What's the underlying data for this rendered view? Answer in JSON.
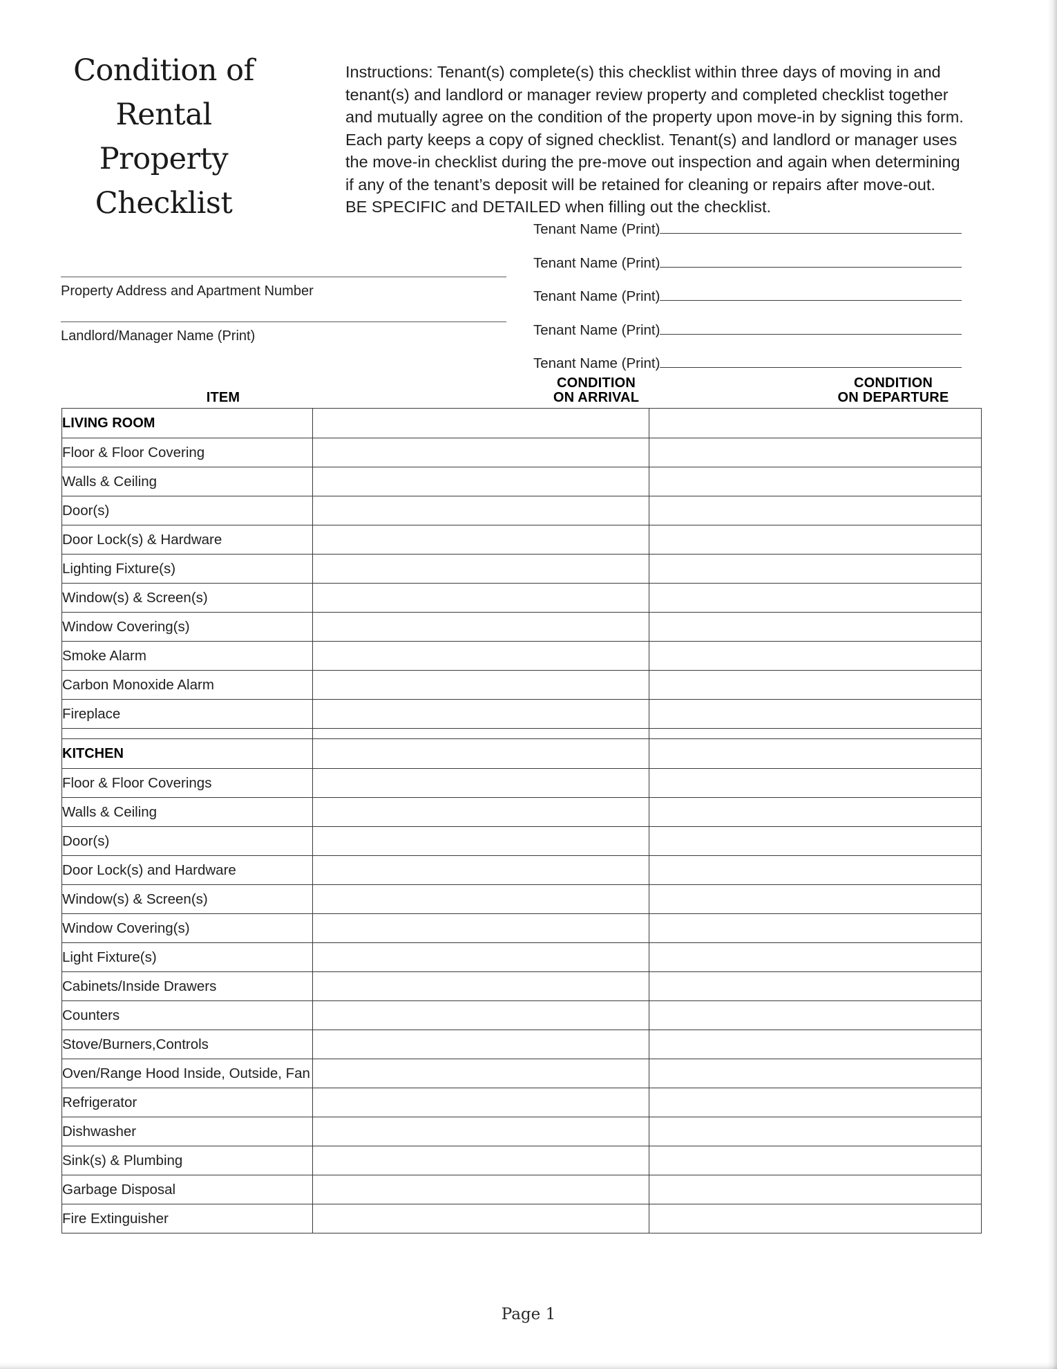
{
  "document": {
    "title_lines": [
      "Condition of",
      "Rental",
      "Property",
      "Checklist"
    ],
    "instructions_label": "Instructions:",
    "instructions_body": "Instructions:  Tenant(s) complete(s) this checklist within three days of moving in and tenant(s) and landlord or manager review property and completed checklist together and mutually agree on the condition of the property upon move-in by signing this form.  Each party keeps a copy of signed checklist.  Tenant(s) and landlord or manager uses the move-in checklist during the pre-move out inspection and again when determining if any of the tenant’s deposit will be retained for cleaning or repairs after move-out.",
    "instructions_emphasis": "BE SPECIFIC and DETAILED when filling out the checklist.",
    "footer": "Page 1"
  },
  "fields": {
    "property_address_label": "Property Address and Apartment Number",
    "landlord_name_label": "Landlord/Manager Name (Print)",
    "property_address_value": "",
    "landlord_name_value": "",
    "tenant_name_label": "Tenant Name (Print)",
    "tenant_lines": [
      {
        "label": "Tenant Name (Print)",
        "value": ""
      },
      {
        "label": "Tenant Name (Print)",
        "value": ""
      },
      {
        "label": "Tenant Name (Print)",
        "value": ""
      },
      {
        "label": "Tenant Name (Print)",
        "value": ""
      },
      {
        "label": "Tenant Name (Print)",
        "value": ""
      }
    ]
  },
  "table": {
    "headers": {
      "item": "ITEM",
      "arrival_line1": "CONDITION",
      "arrival_line2": "ON ARRIVAL",
      "departure_line1": "CONDITION",
      "departure_line2": "ON DEPARTURE"
    },
    "rows": [
      {
        "type": "section",
        "label": "LIVING ROOM",
        "arrival": "",
        "departure": ""
      },
      {
        "type": "item",
        "label": "Floor & Floor Covering",
        "arrival": "",
        "departure": ""
      },
      {
        "type": "item",
        "label": "Walls & Ceiling",
        "arrival": "",
        "departure": ""
      },
      {
        "type": "item",
        "label": "Door(s)",
        "arrival": "",
        "departure": ""
      },
      {
        "type": "item",
        "label": "Door Lock(s) & Hardware",
        "arrival": "",
        "departure": ""
      },
      {
        "type": "item",
        "label": "Lighting Fixture(s)",
        "arrival": "",
        "departure": ""
      },
      {
        "type": "item",
        "label": "Window(s) & Screen(s)",
        "arrival": "",
        "departure": ""
      },
      {
        "type": "item",
        "label": "Window Covering(s)",
        "arrival": "",
        "departure": ""
      },
      {
        "type": "item",
        "label": "Smoke Alarm",
        "arrival": "",
        "departure": ""
      },
      {
        "type": "item",
        "label": "Carbon Monoxide Alarm",
        "arrival": "",
        "departure": ""
      },
      {
        "type": "item",
        "label": "Fireplace",
        "arrival": "",
        "departure": ""
      },
      {
        "type": "spacer",
        "label": "",
        "arrival": "",
        "departure": ""
      },
      {
        "type": "section",
        "label": "KITCHEN",
        "arrival": "",
        "departure": ""
      },
      {
        "type": "item",
        "label": "Floor & Floor Coverings",
        "arrival": "",
        "departure": ""
      },
      {
        "type": "item",
        "label": "Walls & Ceiling",
        "arrival": "",
        "departure": ""
      },
      {
        "type": "item",
        "label": "Door(s)",
        "arrival": "",
        "departure": ""
      },
      {
        "type": "item",
        "label": "Door Lock(s) and Hardware",
        "arrival": "",
        "departure": ""
      },
      {
        "type": "item",
        "label": "Window(s) & Screen(s)",
        "arrival": "",
        "departure": ""
      },
      {
        "type": "item",
        "label": "Window Covering(s)",
        "arrival": "",
        "departure": ""
      },
      {
        "type": "item",
        "label": "Light Fixture(s)",
        "arrival": "",
        "departure": ""
      },
      {
        "type": "item",
        "label": "Cabinets/Inside Drawers",
        "arrival": "",
        "departure": ""
      },
      {
        "type": "item",
        "label": "Counters",
        "arrival": "",
        "departure": ""
      },
      {
        "type": "item",
        "label": "Stove/Burners,Controls",
        "arrival": "",
        "departure": ""
      },
      {
        "type": "item",
        "label": "Oven/Range Hood Inside, Outside, Fan",
        "arrival": "",
        "departure": ""
      },
      {
        "type": "item",
        "label": "Refrigerator",
        "arrival": "",
        "departure": ""
      },
      {
        "type": "item",
        "label": "Dishwasher",
        "arrival": "",
        "departure": ""
      },
      {
        "type": "item",
        "label": "Sink(s) & Plumbing",
        "arrival": "",
        "departure": ""
      },
      {
        "type": "item",
        "label": "Garbage Disposal",
        "arrival": "",
        "departure": ""
      },
      {
        "type": "item",
        "label": "Fire Extinguisher",
        "arrival": "",
        "departure": ""
      }
    ]
  }
}
